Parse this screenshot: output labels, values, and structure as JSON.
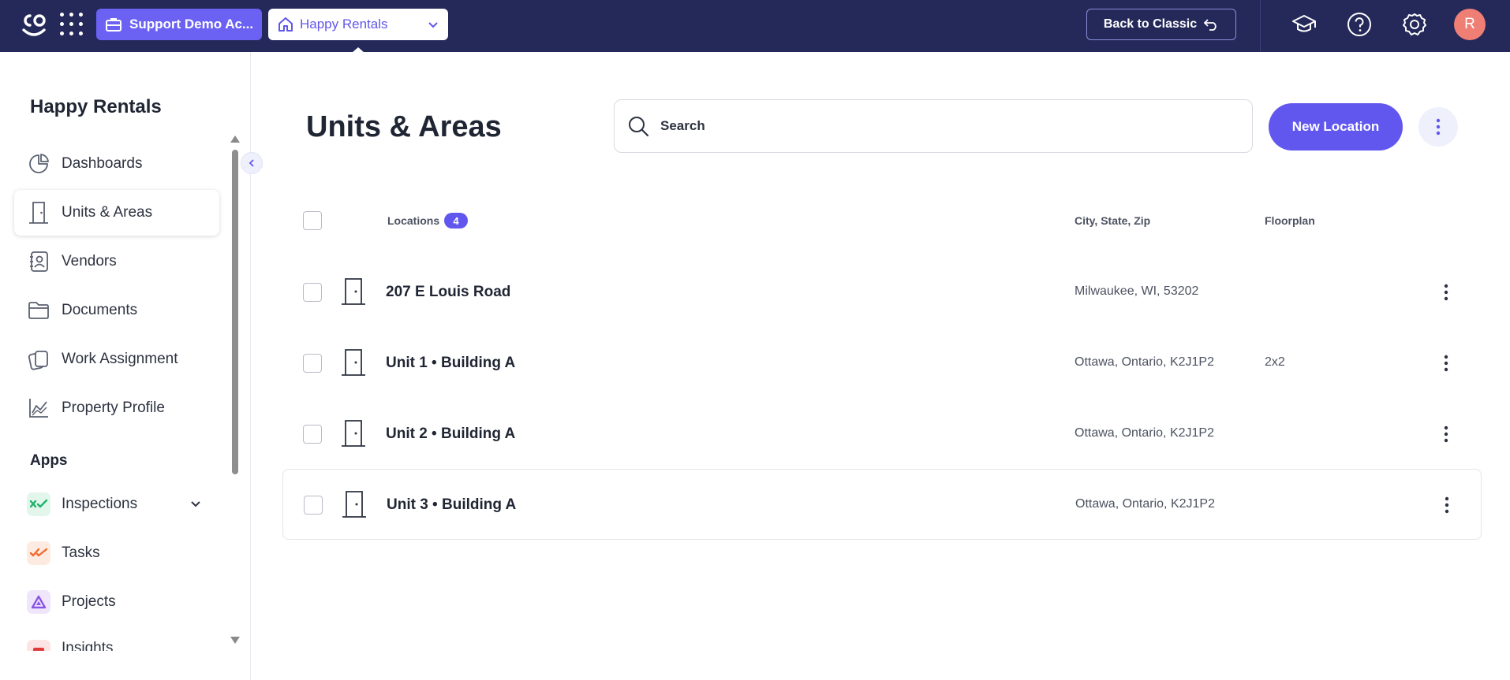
{
  "topbar": {
    "account": "Support Demo Ac...",
    "property": "Happy Rentals",
    "back_classic": "Back to Classic",
    "avatar_initial": "R"
  },
  "sidebar": {
    "title": "Happy Rentals",
    "items": [
      {
        "label": "Dashboards",
        "icon": "pie-chart-icon"
      },
      {
        "label": "Units & Areas",
        "icon": "door-icon",
        "active": true
      },
      {
        "label": "Vendors",
        "icon": "contact-book-icon"
      },
      {
        "label": "Documents",
        "icon": "folder-icon"
      },
      {
        "label": "Work Assignment",
        "icon": "stacked-cards-icon"
      },
      {
        "label": "Property Profile",
        "icon": "line-chart-icon"
      }
    ],
    "apps_title": "Apps",
    "apps": [
      {
        "label": "Inspections",
        "icon": "inspections-icon",
        "color": "#1fb36b"
      },
      {
        "label": "Tasks",
        "icon": "tasks-icon",
        "color": "#f26a2e"
      },
      {
        "label": "Projects",
        "icon": "projects-icon",
        "color": "#8a55e6"
      },
      {
        "label": "Insights",
        "icon": "insights-icon",
        "color": "#e03b3b"
      }
    ]
  },
  "main": {
    "title": "Units & Areas",
    "search_placeholder": "Search",
    "new_location": "New Location",
    "table": {
      "col_locations": "Locations",
      "count": "4",
      "col_city": "City, State, Zip",
      "col_floorplan": "Floorplan",
      "rows": [
        {
          "name": "207 E Louis Road",
          "city": "Milwaukee, WI, 53202",
          "floorplan": ""
        },
        {
          "name": "Unit 1 • Building A",
          "city": "Ottawa, Ontario, K2J1P2",
          "floorplan": "2x2"
        },
        {
          "name": "Unit 2 • Building A",
          "city": "Ottawa, Ontario, K2J1P2",
          "floorplan": ""
        },
        {
          "name": "Unit 3 • Building A",
          "city": "Ottawa, Ontario, K2J1P2",
          "floorplan": ""
        }
      ]
    }
  },
  "colors": {
    "topbar_bg": "#24295a",
    "accent": "#6157ef",
    "avatar": "#ef7f74"
  }
}
